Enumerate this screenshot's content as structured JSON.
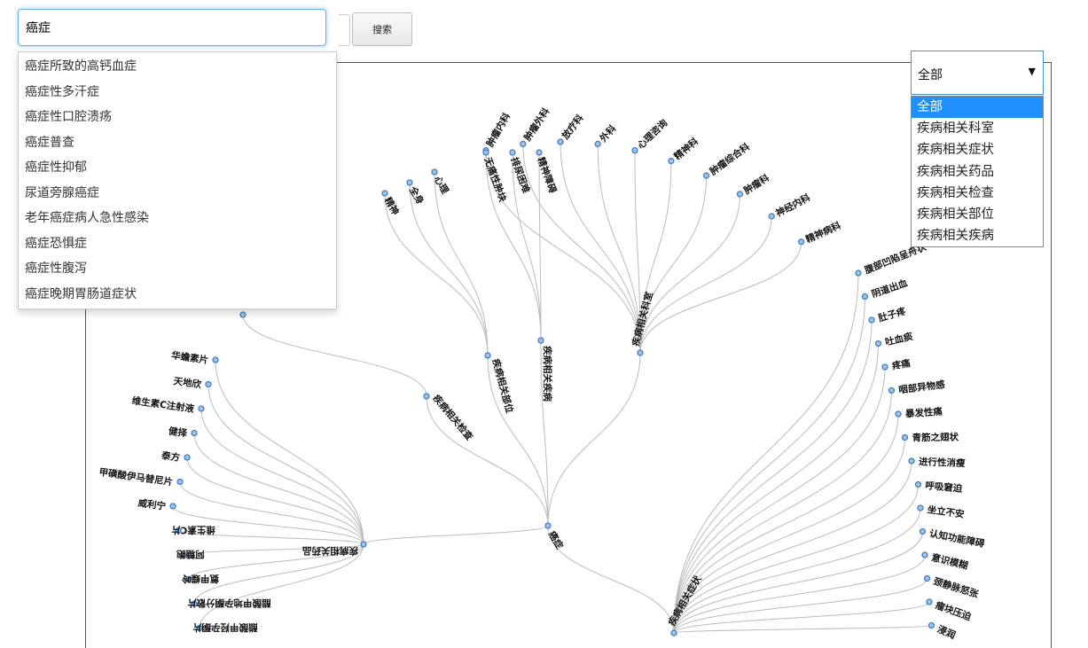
{
  "search": {
    "value": "癌症",
    "button_label": "搜索",
    "suggestions": [
      "癌症所致的高钙血症",
      "癌症性多汗症",
      "癌症性口腔溃疡",
      "癌症普查",
      "癌症性抑郁",
      "尿道旁腺癌症",
      "老年癌症病人急性感染",
      "癌症恐惧症",
      "癌症性腹泻",
      "癌症晚期胃肠道症状"
    ]
  },
  "filter": {
    "selected": "全部",
    "options": [
      "全部",
      "疾病相关科室",
      "疾病相关症状",
      "疾病相关药品",
      "疾病相关检查",
      "疾病相关部位",
      "疾病相关疾病"
    ]
  },
  "graph": {
    "root": "癌症",
    "categories": [
      {
        "name": "疾病相关科室",
        "children": [
          "肿瘤内科",
          "肿瘤外科",
          "放疗科",
          "外科",
          "心理咨询",
          "精神科",
          "肿瘤综合科",
          "肿瘤科",
          "神经内科",
          "精神病科"
        ]
      },
      {
        "name": "疾病相关疾病",
        "children": [
          "无痛性肿块",
          "排尿困难",
          "精神障碍"
        ]
      },
      {
        "name": "疾病相关部位",
        "children": [
          "精神",
          "全身",
          "心理"
        ]
      },
      {
        "name": "疾病相关检查",
        "children": [
          ""
        ]
      },
      {
        "name": "疾病相关药品",
        "children": [
          "华蟾素片",
          "天地欣",
          "维生素C注射液",
          "健择",
          "泰方",
          "甲磺酸伊马替尼片",
          "威利宁",
          "维生素C片",
          "阿糖胞",
          "氨甲蝶呤",
          "醋酸甲地孕酮分散片",
          "醋酸甲羟孕酮片"
        ]
      },
      {
        "name": "疾病相关症状",
        "children": [
          "腹部凹陷呈舟状",
          "阴道出血",
          "肚子疼",
          "吐血痰",
          "疼痛",
          "咽部异物感",
          "暴发性痛",
          "青筋之翅状",
          "进行性消瘦",
          "呼吸窘迫",
          "坐立不安",
          "认知功能障碍",
          "意识模糊",
          "颈静脉怒张",
          "瘤块压迫",
          "浸润"
        ]
      }
    ]
  }
}
